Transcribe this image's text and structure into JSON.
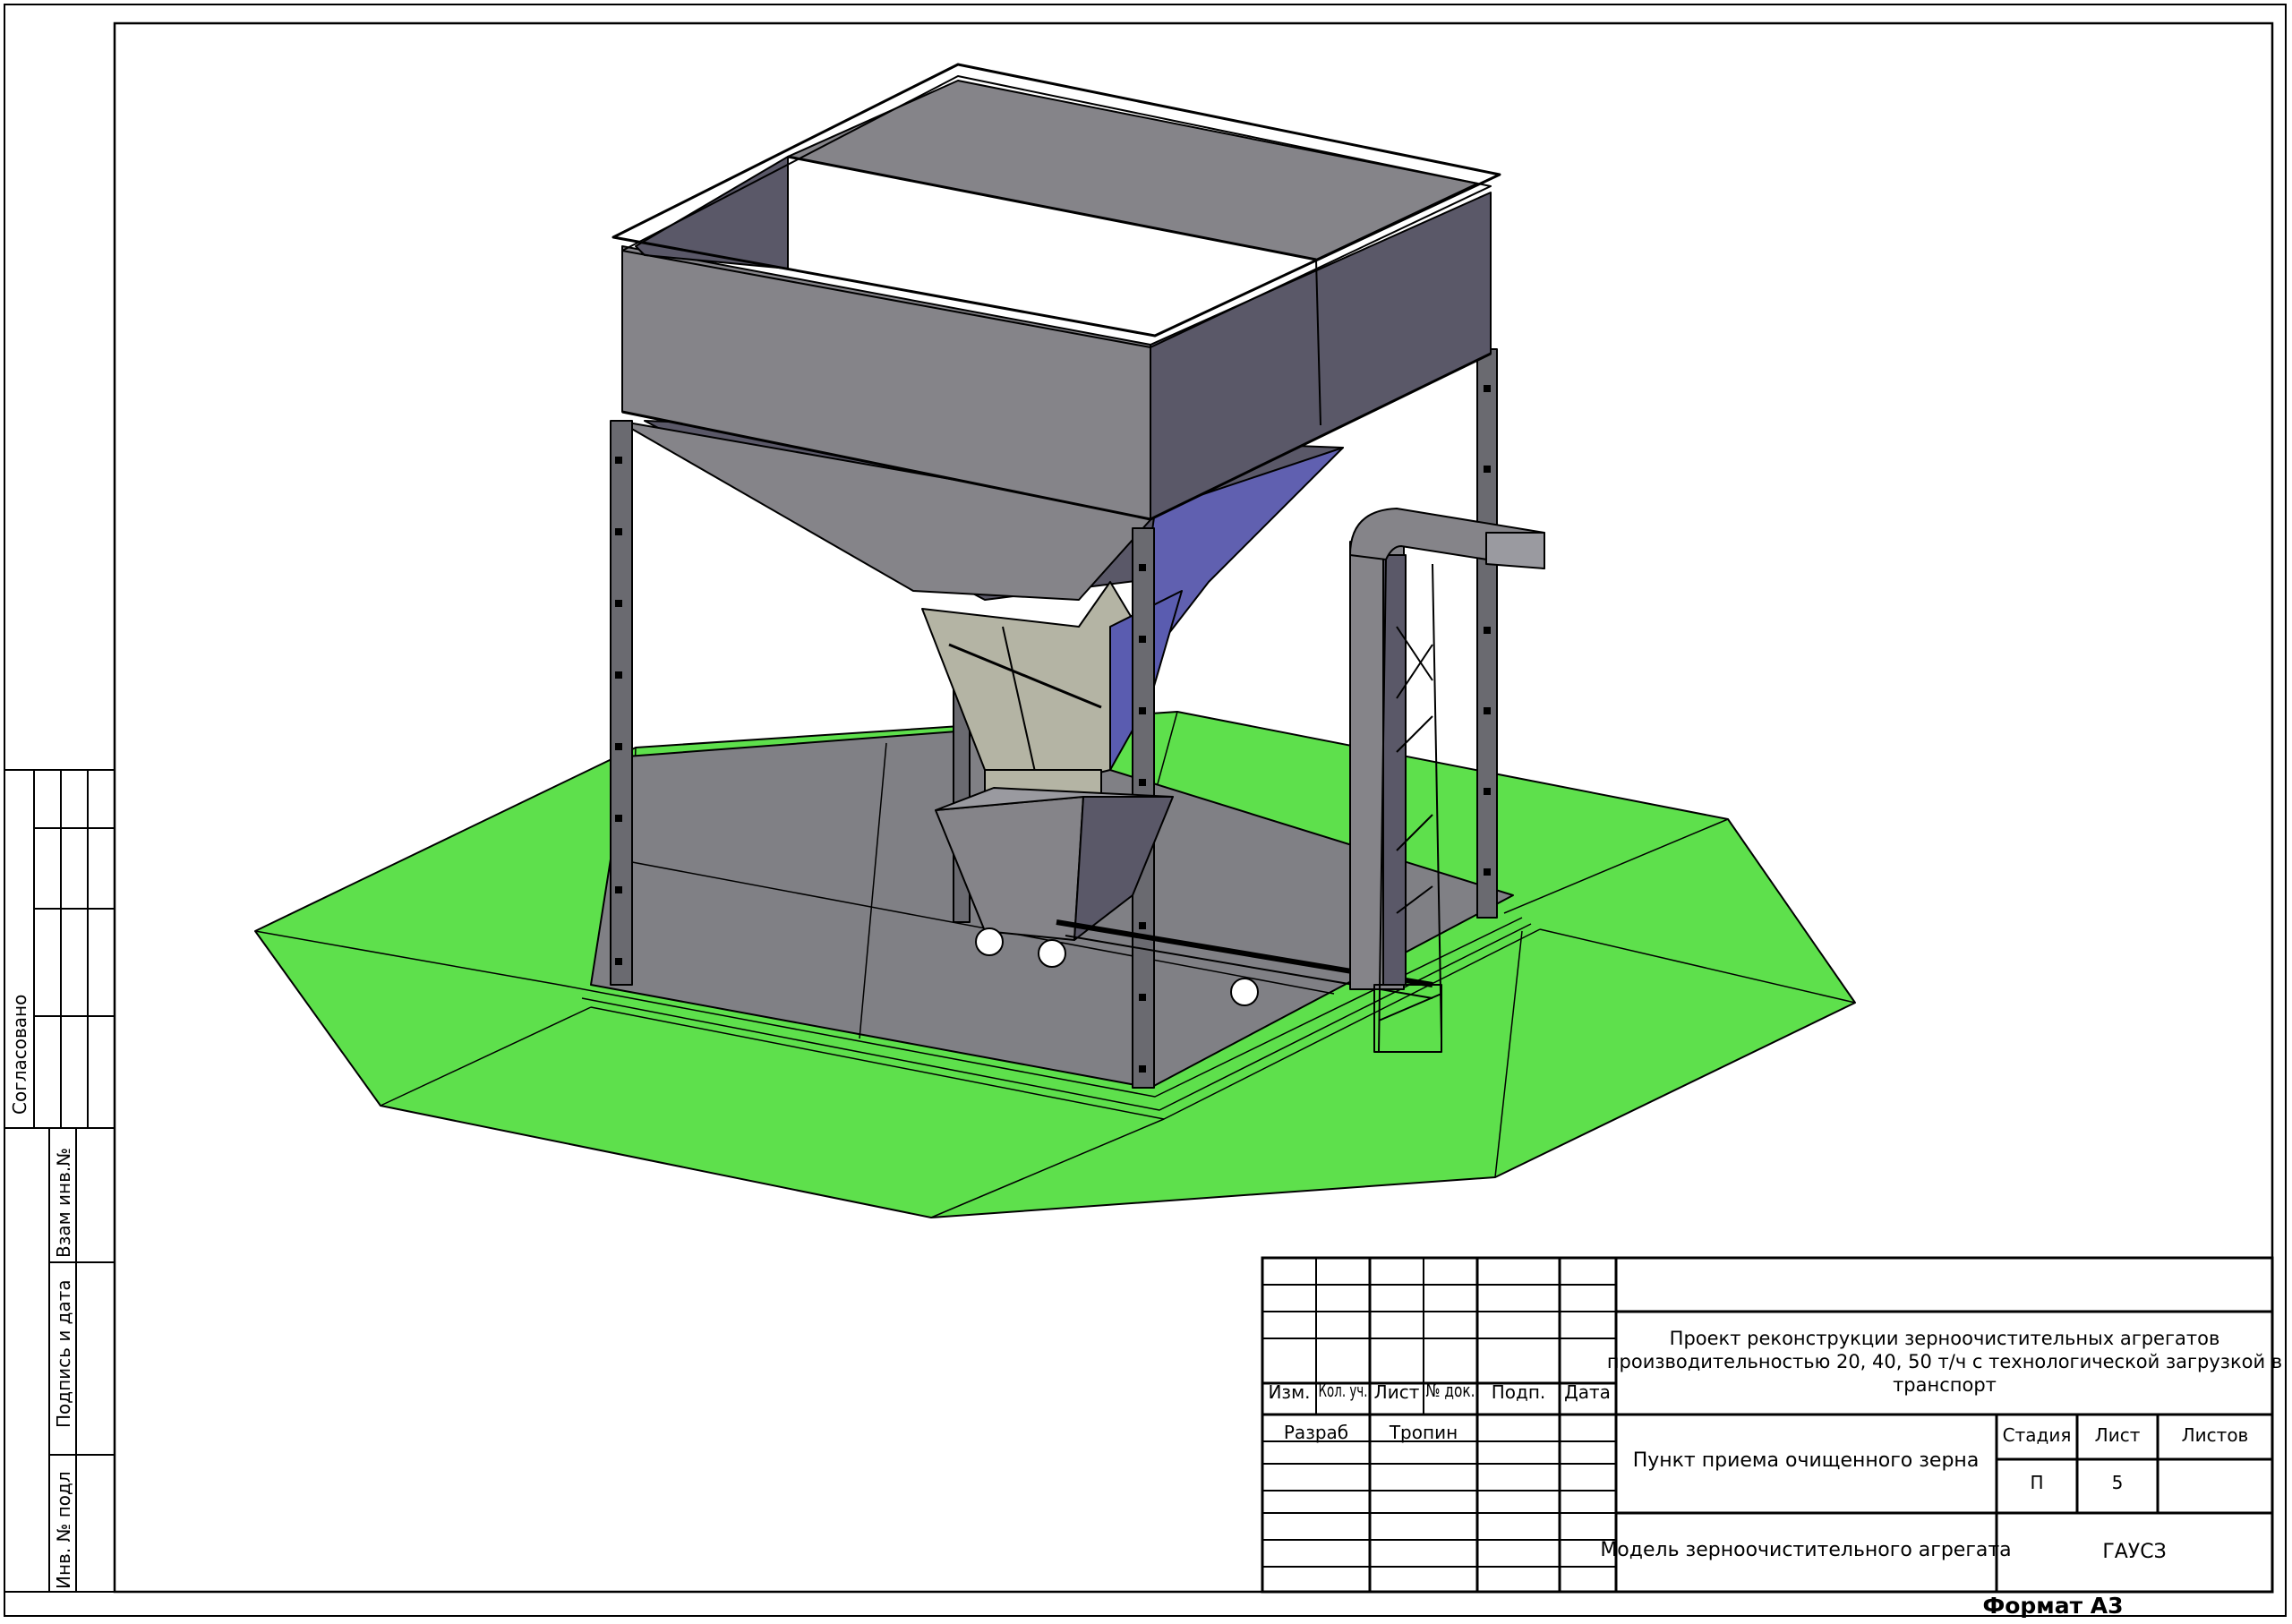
{
  "side_stamp": {
    "agreed": "Согласовано",
    "replace_inv": "Взам инв.№",
    "sign_date": "Подпись и дата",
    "inv_orig": "Инв. № подл"
  },
  "title_block": {
    "headers": [
      "Изм.",
      "Кол. уч.",
      "Лист",
      "№ док.",
      "Подп.",
      "Дата"
    ],
    "developer_role": "Разраб",
    "developer_name": "Тропин",
    "project_title_1": "Проект реконструкции зерноочистительных агрегатов",
    "project_title_2": "производительностью 20, 40, 50 т/ч с технологической загрузкой в",
    "project_title_3": "транспорт",
    "object_name": "Пункт приема очищенного зерна",
    "sheet_name": "Модель зерноочистительного агрегата",
    "stage_label": "Стадия",
    "sheet_label": "Лист",
    "sheets_label": "Листов",
    "stage_value": "П",
    "sheet_value": "5",
    "sheets_value": "",
    "org": "ГАУСЗ"
  },
  "format_label": "Формат А3",
  "colors": {
    "ground": "#5ee04c",
    "hopper_light": "#858489",
    "hopper_dark": "#5a5868",
    "floor": "#808085",
    "blue_panel": "#5a5cb0",
    "cone_light": "#b4b4a4"
  }
}
